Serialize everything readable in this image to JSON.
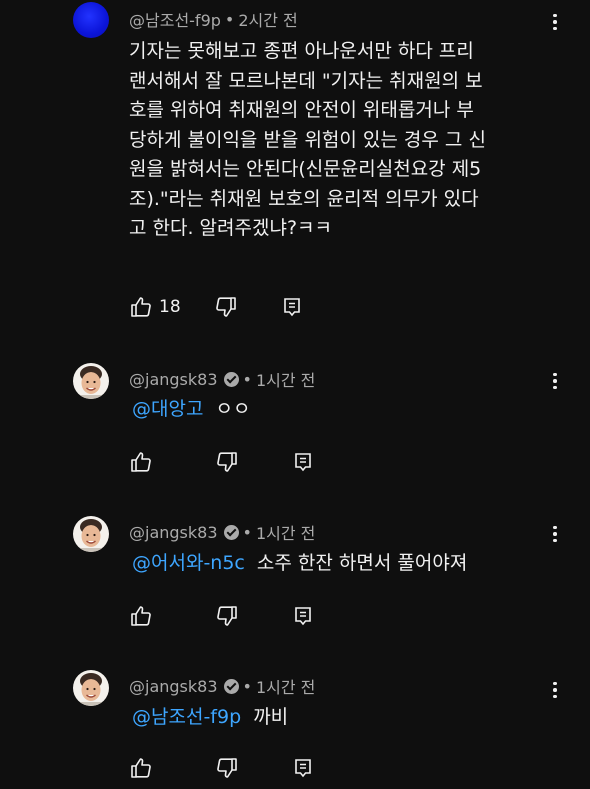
{
  "comments": [
    {
      "author": "@남조선-f9p",
      "time": "2시간 전",
      "verified": false,
      "avatar": "blue-circle-avatar",
      "lines": [
        "기자는 못해보고 종편 아나운서만 하다 프리",
        "랜서해서 잘 모르나본데 \"기자는 취재원의 보",
        "호를 위하여 취재원의 안전이 위태롭거나 부",
        "당하게 불이익을 받을 위험이 있는 경우 그 신",
        "원을 밝혀서는 안된다(신문윤리실천요강 제5",
        "조).\"라는 취재원 보호의 윤리적 의무가 있다",
        "고 한다. 알려주겠냐?ㅋㅋ"
      ],
      "likes": "18"
    },
    {
      "author": "@jangsk83",
      "time": "1시간 전",
      "verified": true,
      "mention": "@대앙고",
      "text": "ㅇㅇ",
      "likes": ""
    },
    {
      "author": "@jangsk83",
      "time": "1시간 전",
      "verified": true,
      "mention": "@어서와-n5c",
      "text": "소주 한잔 하면서 풀어야져",
      "likes": ""
    },
    {
      "author": "@jangsk83",
      "time": "1시간 전",
      "verified": true,
      "mention": "@남조선-f9p",
      "text": "까비",
      "likes": ""
    }
  ],
  "separator": "•",
  "icons": {
    "like": "thumbs-up-icon",
    "dislike": "thumbs-down-icon",
    "reply": "reply-icon",
    "more": "more-vertical-icon"
  },
  "colors": {
    "background": "#0f0f0f",
    "text": "#f1f1f1",
    "meta": "#aaaaaa",
    "mention": "#3ea6ff"
  }
}
